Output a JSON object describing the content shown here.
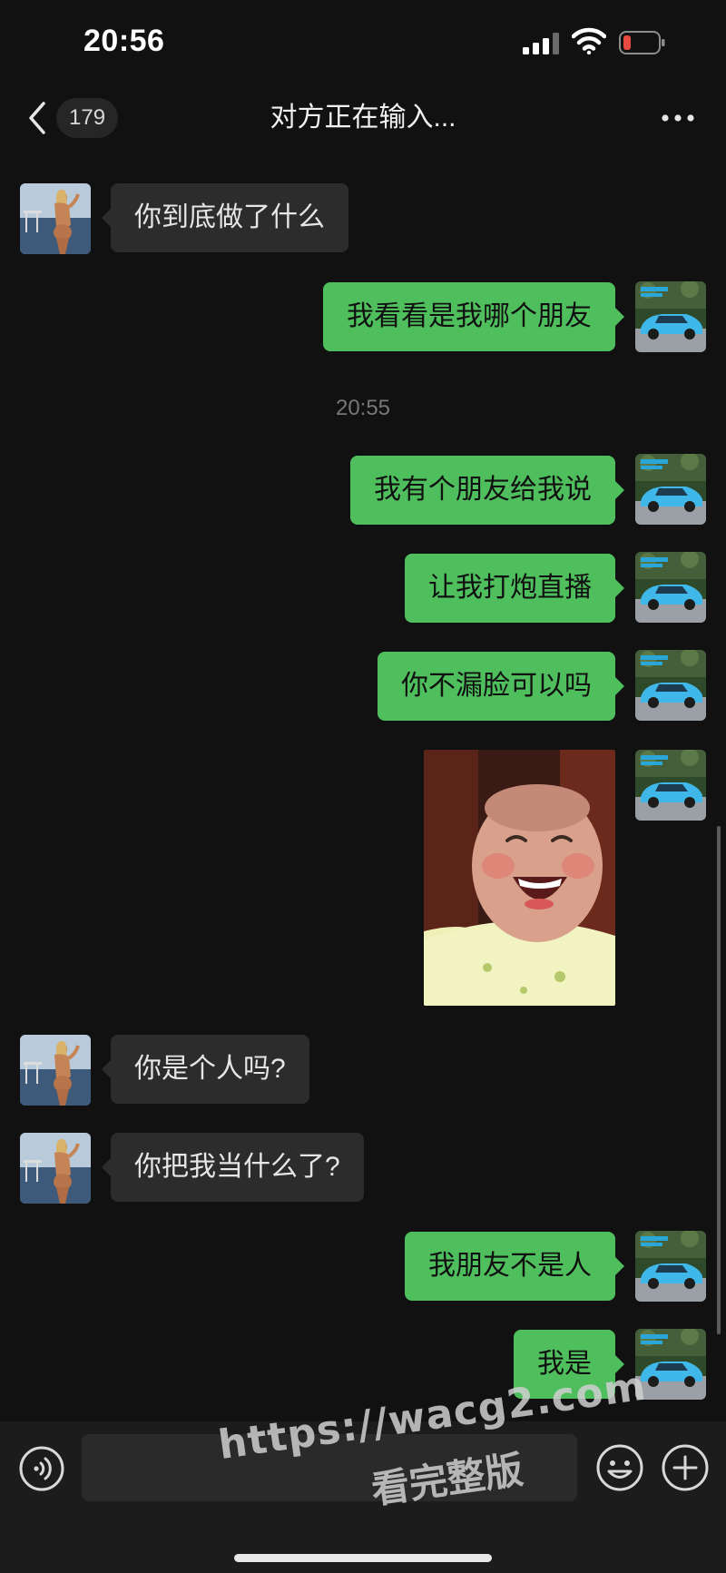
{
  "status_bar": {
    "time": "20:56"
  },
  "nav": {
    "unread_count": "179",
    "title": "对方正在输入..."
  },
  "messages": [
    {
      "side": "in",
      "text": "你到底做了什么"
    },
    {
      "side": "out",
      "text": "我看看是我哪个朋友"
    },
    {
      "type": "timestamp",
      "text": "20:55"
    },
    {
      "side": "out",
      "text": "我有个朋友给我说"
    },
    {
      "side": "out",
      "text": "让我打炮直播"
    },
    {
      "side": "out",
      "text": "你不漏脸可以吗"
    },
    {
      "side": "out",
      "type": "sticker",
      "icon": "laughing-baby-sticker"
    },
    {
      "side": "in",
      "text": "你是个人吗?"
    },
    {
      "side": "in",
      "text": "你把我当什么了?"
    },
    {
      "side": "out",
      "text": "我朋友不是人"
    },
    {
      "side": "out",
      "text": "我是"
    }
  ],
  "input_bar": {
    "placeholder": "",
    "icons": [
      "voice-icon",
      "emoji-icon",
      "plus-icon"
    ]
  },
  "watermark": {
    "url": "https://wacg2.com",
    "subtitle": "看完整版"
  },
  "colors": {
    "background": "#111111",
    "incoming_bubble": "#2c2c2c",
    "outgoing_bubble": "#4fbf5e",
    "battery_low": "#e84a3f"
  }
}
